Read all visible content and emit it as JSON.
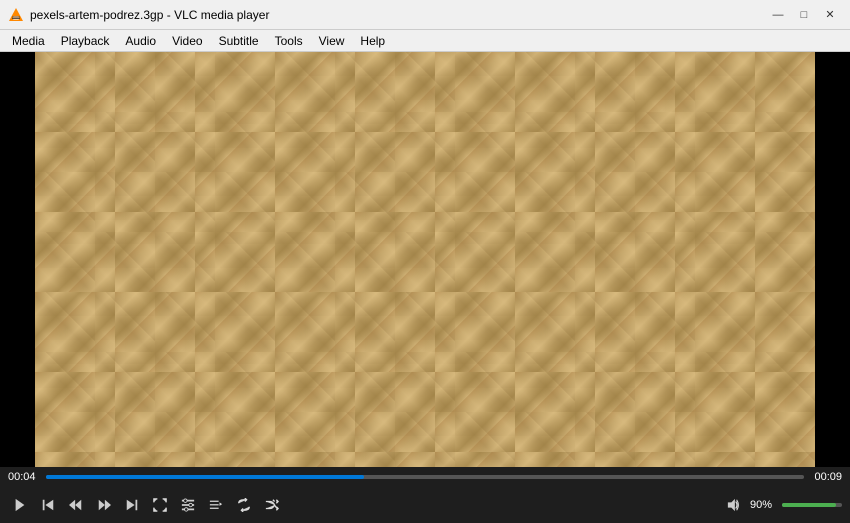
{
  "titleBar": {
    "icon": "vlc",
    "title": "pexels-artem-podrez.3gp - VLC media player",
    "minimize": "—",
    "maximize": "□",
    "close": "✕"
  },
  "menuBar": {
    "items": [
      {
        "id": "media",
        "label": "Media"
      },
      {
        "id": "playback",
        "label": "Playback"
      },
      {
        "id": "audio",
        "label": "Audio"
      },
      {
        "id": "video",
        "label": "Video"
      },
      {
        "id": "subtitle",
        "label": "Subtitle"
      },
      {
        "id": "tools",
        "label": "Tools"
      },
      {
        "id": "view",
        "label": "View"
      },
      {
        "id": "help",
        "label": "Help"
      }
    ]
  },
  "controls": {
    "timeElapsed": "00:04",
    "timeTotal": "00:09",
    "progressPercent": 42,
    "volumePercent": 90,
    "volumeLabel": "90%",
    "buttons": {
      "play": "▶",
      "prev": "⏮",
      "rewind": "⏪",
      "fastforward": "⏩",
      "fullscreen": "⛶",
      "extended": "⚙",
      "playlist": "☰",
      "loop": "↺",
      "random": "⤮",
      "volume": "🔊"
    }
  }
}
